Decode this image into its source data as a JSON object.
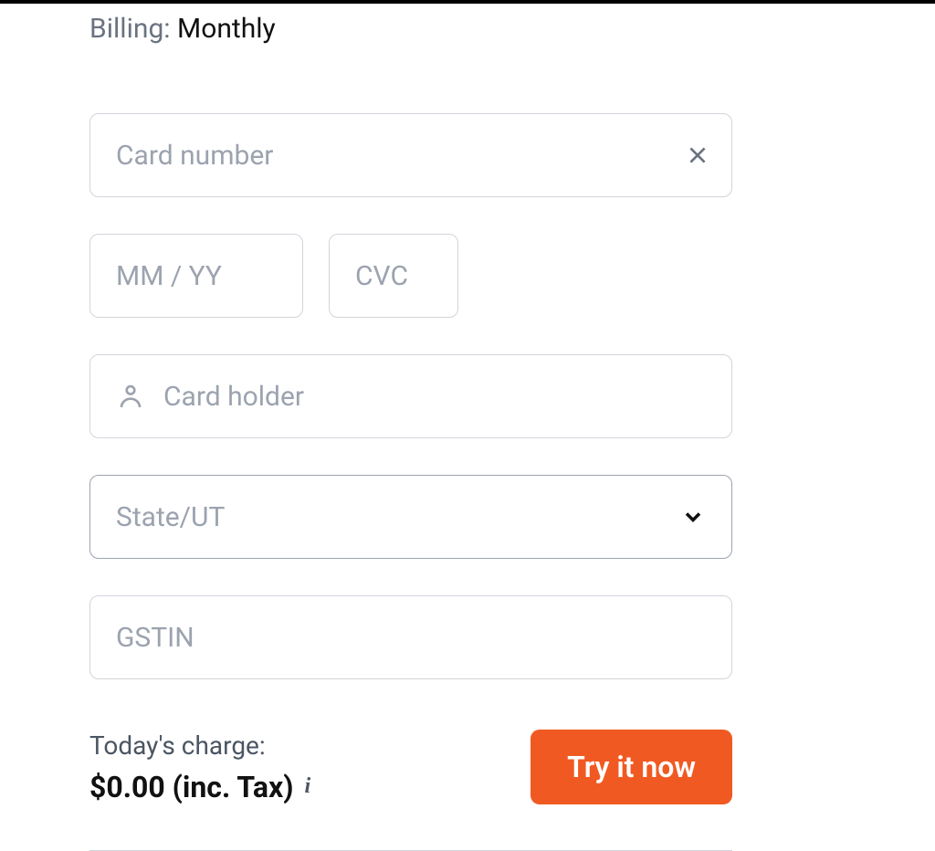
{
  "billing": {
    "label": "Billing:",
    "value": "Monthly"
  },
  "form": {
    "card_number_placeholder": "Card number",
    "expiry_placeholder": "MM / YY",
    "cvc_placeholder": "CVC",
    "card_holder_placeholder": "Card holder",
    "state_placeholder": "State/UT",
    "gstin_placeholder": "GSTIN"
  },
  "footer": {
    "charge_label": "Today's charge:",
    "charge_amount": "$0.00 (inc. Tax)",
    "cta_label": "Try it now"
  },
  "icons": {
    "clear": "close-icon",
    "person": "person-icon",
    "chevron": "chevron-down-icon",
    "info": "i"
  }
}
